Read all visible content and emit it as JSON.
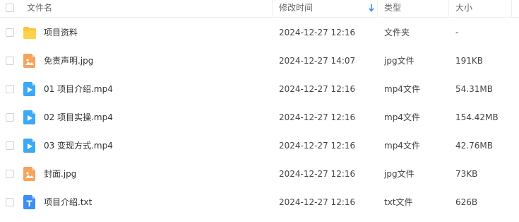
{
  "header": {
    "name_label": "文件名",
    "modified_label": "修改时间",
    "type_label": "类型",
    "size_label": "大小"
  },
  "rows": [
    {
      "name": "项目资料",
      "date": "2024-12-27 12:16",
      "type": "文件夹",
      "size": "-",
      "icon": "folder-icon"
    },
    {
      "name": "免责声明.jpg",
      "date": "2024-12-27 14:07",
      "type": "jpg文件",
      "size": "191KB",
      "icon": "image-file-icon"
    },
    {
      "name": "01 项目介绍.mp4",
      "date": "2024-12-27 12:16",
      "type": "mp4文件",
      "size": "54.31MB",
      "icon": "video-file-icon"
    },
    {
      "name": "02 项目实操.mp4",
      "date": "2024-12-27 12:16",
      "type": "mp4文件",
      "size": "154.42MB",
      "icon": "video-file-icon"
    },
    {
      "name": "03 变现方式.mp4",
      "date": "2024-12-27 12:16",
      "type": "mp4文件",
      "size": "42.76MB",
      "icon": "video-file-icon"
    },
    {
      "name": "封面.jpg",
      "date": "2024-12-27 12:16",
      "type": "jpg文件",
      "size": "73KB",
      "icon": "image-file-icon"
    },
    {
      "name": "项目介绍.txt",
      "date": "2024-12-27 12:16",
      "type": "txt文件",
      "size": "626B",
      "icon": "text-file-icon"
    }
  ],
  "colors": {
    "folder": "#f9c634",
    "image": "#f7a35c",
    "video": "#3da8f5",
    "text": "#3a8ef6",
    "sort_arrow": "#3b8cf5"
  }
}
